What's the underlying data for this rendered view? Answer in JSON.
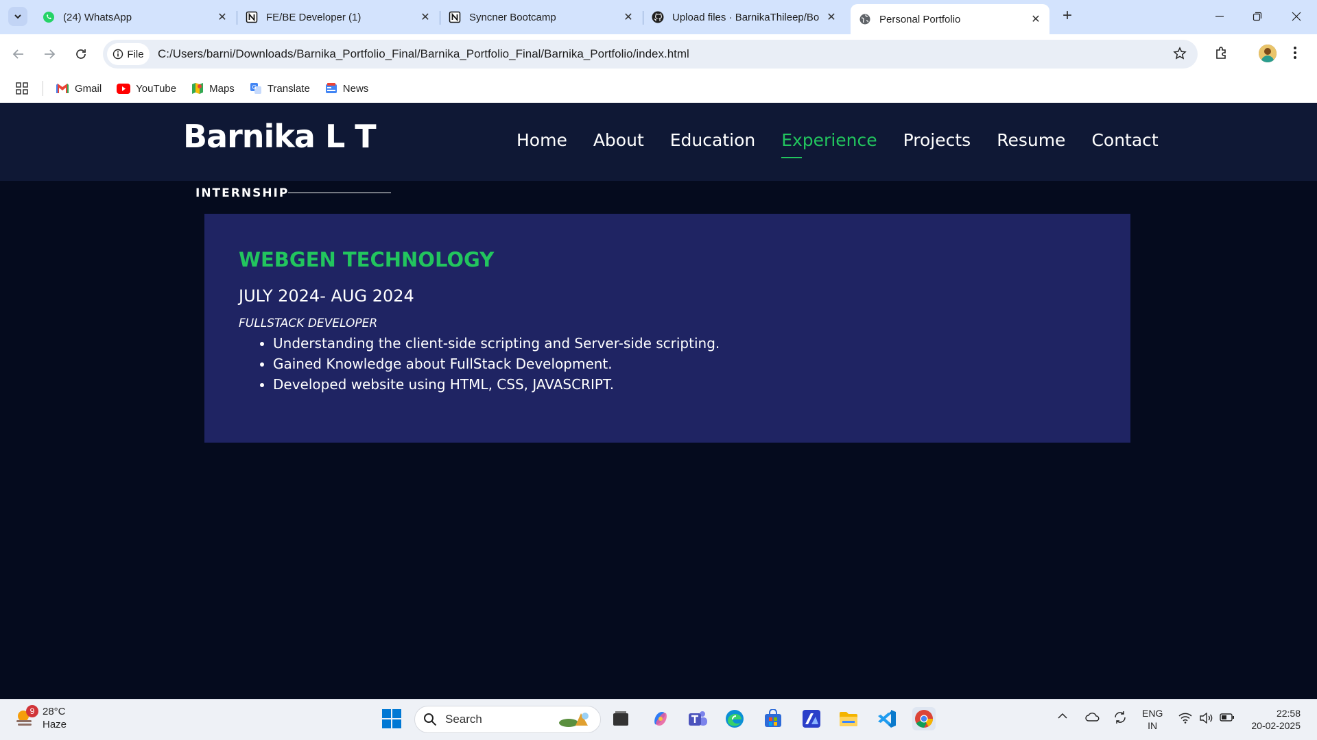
{
  "browser": {
    "tabs": [
      {
        "title": "(24) WhatsApp",
        "icon": "whatsapp-icon"
      },
      {
        "title": "FE/BE Developer (1)",
        "icon": "notion-icon"
      },
      {
        "title": "Syncner Bootcamp",
        "icon": "notion-icon"
      },
      {
        "title": "Upload files · BarnikaThileep/Bo",
        "icon": "github-icon"
      },
      {
        "title": "Personal Portfolio",
        "icon": "globe-icon",
        "active": true
      }
    ],
    "file_chip": "File",
    "url": "C:/Users/barni/Downloads/Barnika_Portfolio_Final/Barnika_Portfolio_Final/Barnika_Portfolio/index.html",
    "bookmarks": [
      {
        "label": "Gmail",
        "icon": "gmail-icon"
      },
      {
        "label": "YouTube",
        "icon": "youtube-icon"
      },
      {
        "label": "Maps",
        "icon": "maps-icon"
      },
      {
        "label": "Translate",
        "icon": "translate-icon"
      },
      {
        "label": "News",
        "icon": "news-icon"
      }
    ]
  },
  "site": {
    "brand": "Barnika L T",
    "nav": [
      "Home",
      "About",
      "Education",
      "Experience",
      "Projects",
      "Resume",
      "Contact"
    ],
    "active_nav": "Experience",
    "section_label": "INTERNSHIP",
    "experience": {
      "company": "WEBGEN TECHNOLOGY",
      "dates": "JULY 2024- AUG 2024",
      "role": "FULLSTACK DEVELOPER",
      "points": [
        "Understanding the client-side scripting and Server-side scripting.",
        "Gained Knowledge about FullStack Development.",
        "Developed website using HTML, CSS, JAVASCRIPT."
      ]
    },
    "colors": {
      "nav_bg": "#0f1835",
      "page_bg": "#050b1e",
      "card_bg": "#1f2463",
      "accent": "#22c55e"
    }
  },
  "taskbar": {
    "weather_badge": "9",
    "temperature": "28°C",
    "condition": "Haze",
    "search_placeholder": "Search",
    "lang_top": "ENG",
    "lang_bottom": "IN",
    "time": "22:58",
    "date": "20-02-2025"
  }
}
